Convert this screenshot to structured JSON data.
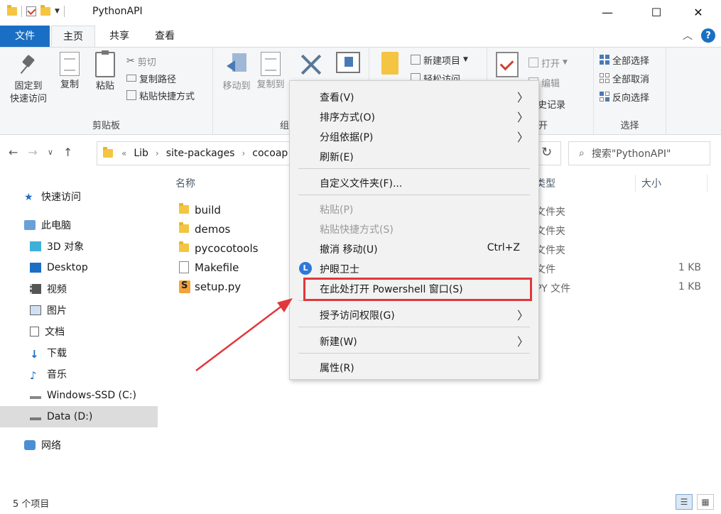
{
  "window": {
    "title": "PythonAPI",
    "minimize": "—",
    "maximize": "☐",
    "close": "✕"
  },
  "tabs": {
    "file": "文件",
    "home": "主页",
    "share": "共享",
    "view": "查看"
  },
  "ribbon": {
    "clipboard": {
      "pin_line1": "固定到",
      "pin_line2": "快速访问",
      "copy": "复制",
      "paste": "粘贴",
      "cut": "剪切",
      "copy_path": "复制路径",
      "paste_shortcut": "粘贴快捷方式",
      "label": "剪贴板"
    },
    "organize": {
      "move_to": "移动到",
      "copy_to": "复制到",
      "label": "组"
    },
    "new": {
      "new_item": "新建项目",
      "easy_access": "轻松访问"
    },
    "open": {
      "open": "打开",
      "edit": "编辑",
      "history": "历史记录",
      "label": "开"
    },
    "select": {
      "select_all": "全部选择",
      "select_none": "全部取消",
      "invert": "反向选择",
      "label": "选择"
    }
  },
  "address": {
    "overflow": "«",
    "crumbs": [
      "Lib",
      "site-packages",
      "cocoap"
    ],
    "search_placeholder": "搜索\"PythonAPI\""
  },
  "sidebar": {
    "items": [
      {
        "label": "快速访问",
        "icon": "star-icon"
      },
      {
        "label": "此电脑",
        "icon": "computer-icon"
      },
      {
        "label": "3D 对象",
        "icon": "cube-icon"
      },
      {
        "label": "Desktop",
        "icon": "desktop-icon"
      },
      {
        "label": "视频",
        "icon": "video-icon"
      },
      {
        "label": "图片",
        "icon": "picture-icon"
      },
      {
        "label": "文档",
        "icon": "document-icon"
      },
      {
        "label": "下载",
        "icon": "download-icon"
      },
      {
        "label": "音乐",
        "icon": "music-icon"
      },
      {
        "label": "Windows-SSD (C:)",
        "icon": "drive-icon"
      },
      {
        "label": "Data (D:)",
        "icon": "drive-icon"
      },
      {
        "label": "网络",
        "icon": "network-icon"
      }
    ]
  },
  "filelist": {
    "columns": {
      "name": "名称",
      "type": "类型",
      "size": "大小"
    },
    "rows": [
      {
        "name": "build",
        "type": "文件夹",
        "size": ""
      },
      {
        "name": "demos",
        "type": "文件夹",
        "size": ""
      },
      {
        "name": "pycocotools",
        "type": "文件夹",
        "size": ""
      },
      {
        "name": "Makefile",
        "type": "文件",
        "size": "1 KB"
      },
      {
        "name": "setup.py",
        "type": "PY 文件",
        "size": "1 KB"
      }
    ]
  },
  "context_menu": {
    "view": "查看(V)",
    "sort": "排序方式(O)",
    "group": "分组依据(P)",
    "refresh": "刷新(E)",
    "customize": "自定义文件夹(F)...",
    "paste": "粘贴(P)",
    "paste_shortcut": "粘贴快捷方式(S)",
    "undo_move": "撤消 移动(U)",
    "undo_shortcut": "Ctrl+Z",
    "eye_guard": "护眼卫士",
    "eye_guard_glyph": "L",
    "powershell": "在此处打开 Powershell 窗口(S)",
    "grant_access": "授予访问权限(G)",
    "new": "新建(W)",
    "properties": "属性(R)"
  },
  "status": {
    "count": "5 个项目"
  },
  "colors": {
    "accent": "#1a6fc4",
    "annotation": "#e2373b"
  }
}
